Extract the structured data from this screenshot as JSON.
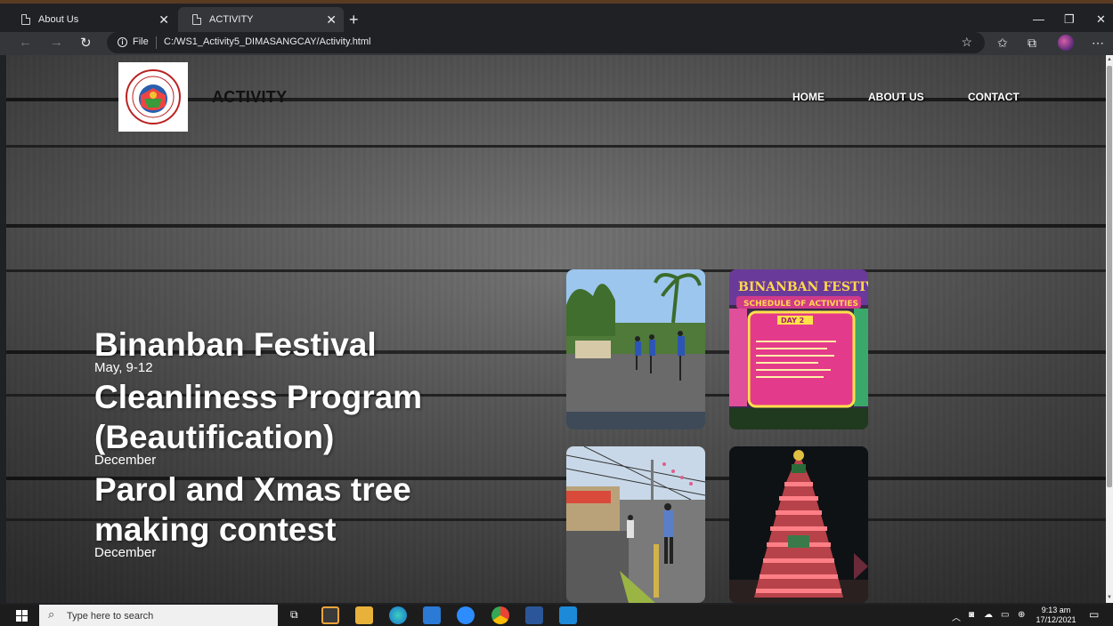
{
  "browser": {
    "tabs": [
      {
        "title": "About Us",
        "active": false
      },
      {
        "title": "ACTIVITY",
        "active": true
      }
    ],
    "address": {
      "scheme_label": "File",
      "url": "C:/WS1_Activity5_DIMASANGCAY/Activity.html"
    }
  },
  "site": {
    "title": "ACTIVITY",
    "nav": [
      "HOME",
      "ABOUT US",
      "CONTACT"
    ]
  },
  "events": [
    {
      "title": "Binanban Festival",
      "date": "May, 9-12"
    },
    {
      "title": "Cleanliness Program (Beautification)",
      "date": "December"
    },
    {
      "title": "Parol and Xmas tree making contest",
      "date": "December"
    }
  ],
  "photos": {
    "poster_heading": "BINANBAN FESTIVAL",
    "poster_subheading": "SCHEDULE OF ACTIVITIES",
    "poster_day": "DAY 2"
  },
  "taskbar": {
    "search_placeholder": "Type here to search",
    "time": "9:13 am",
    "date": "17/12/2021"
  }
}
